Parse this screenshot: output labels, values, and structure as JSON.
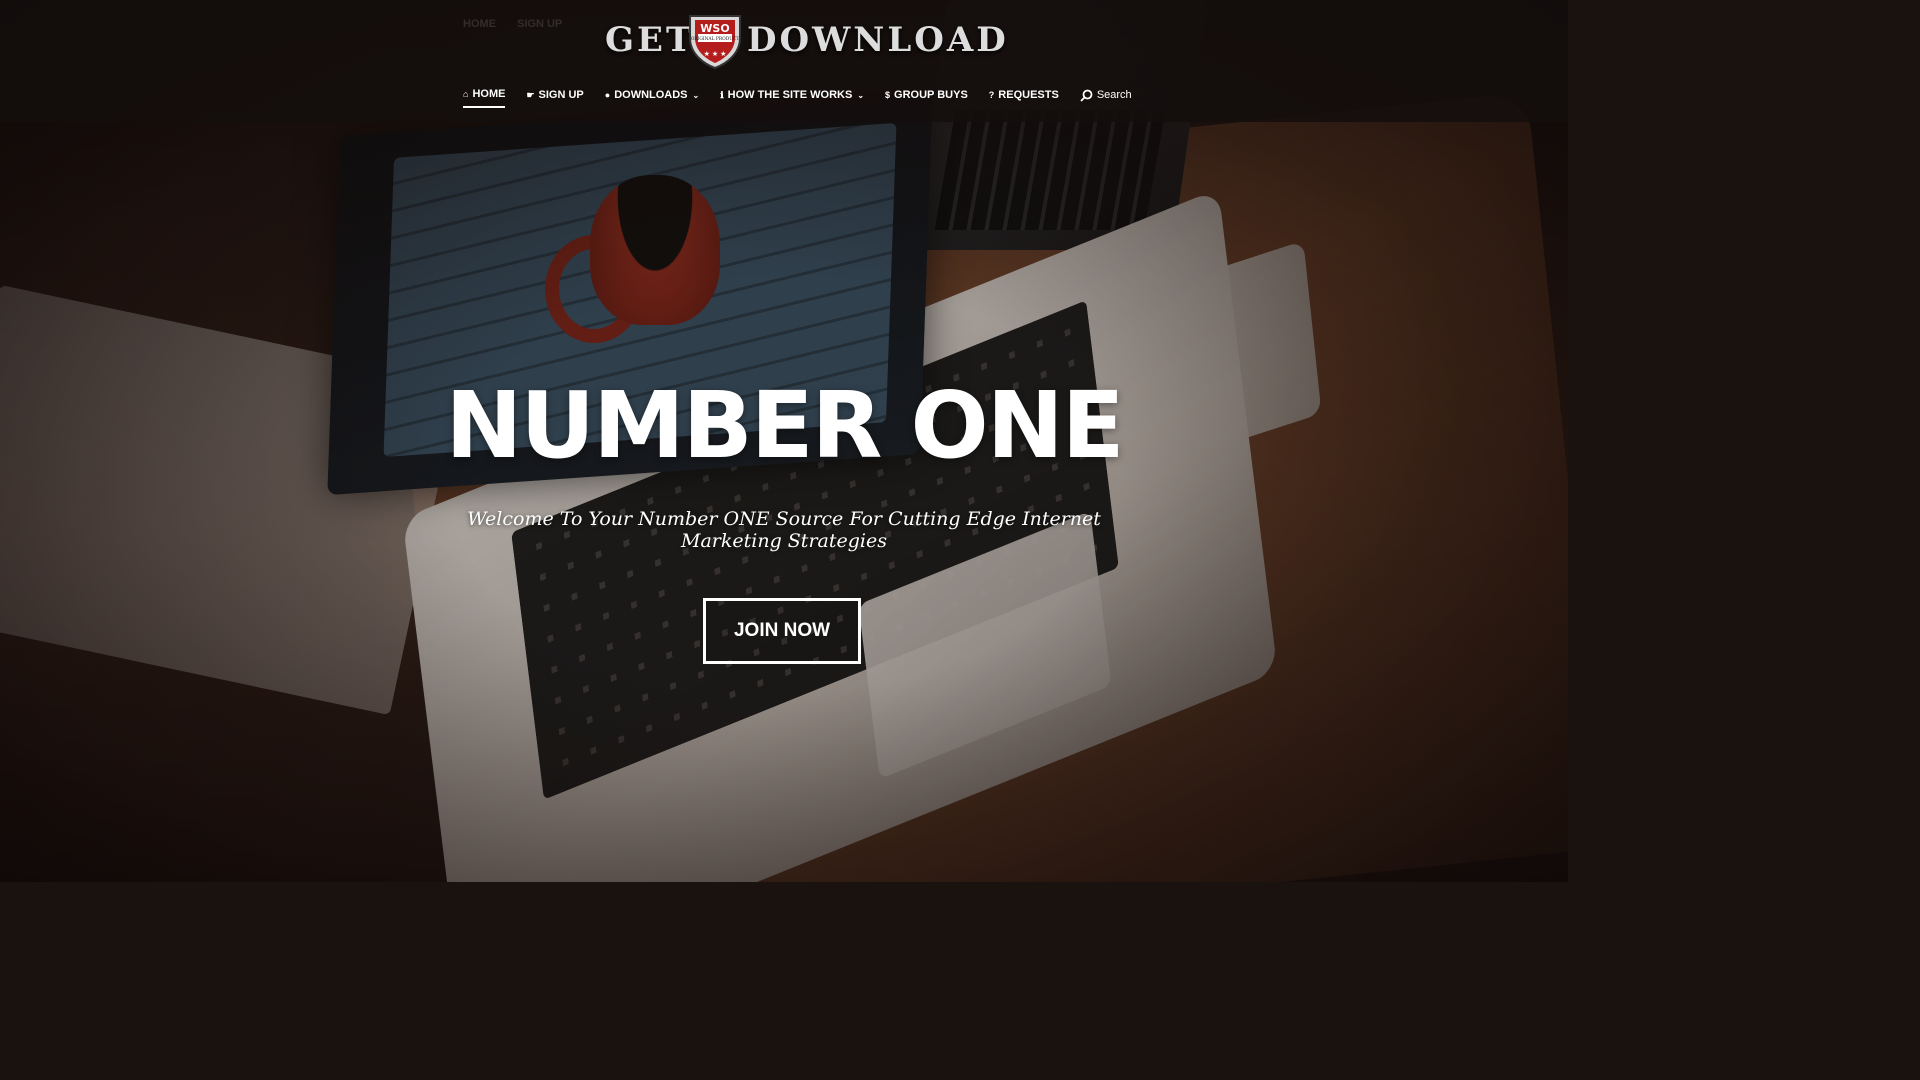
{
  "brand": {
    "left": "GET",
    "right": "DOWNLOAD",
    "shield_text": "WSO",
    "shield_sub": "ORIGINAL PRODUCT"
  },
  "nav": {
    "items": [
      {
        "label": "HOME",
        "icon": "home-icon"
      },
      {
        "label": "SIGN UP",
        "icon": "pointer-icon"
      },
      {
        "label": "DOWNLOADS",
        "icon": "user-icon"
      },
      {
        "label": "HOW THE SITE WORKS",
        "icon": "info-icon"
      },
      {
        "label": "GROUP BUYS",
        "icon": "dollar-icon"
      },
      {
        "label": "REQUESTS",
        "icon": "question-icon"
      }
    ],
    "search_label": "Search"
  },
  "hero": {
    "title": "NUMBER ONE",
    "subtitle": "Welcome To Your Number ONE Source For Cutting Edge Internet Marketing Strategies",
    "cta": "JOIN NOW"
  }
}
